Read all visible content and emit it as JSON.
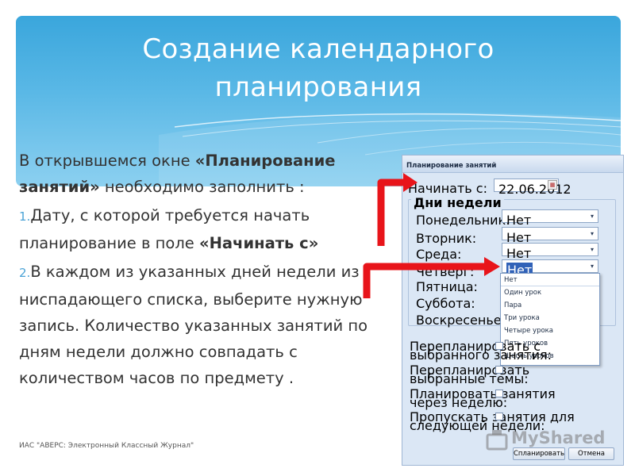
{
  "slide": {
    "title_line1": "Создание календарного",
    "title_line2": "планирования",
    "intro_part1": "В открывшемся окне ",
    "intro_bold": "«Планирование занятий»",
    "intro_part2": " необходимо заполнить :",
    "item1_num": "1.",
    "item1_part1": "Дату, с которой требуется начать планирование в поле ",
    "item1_bold": "«Начинать с»",
    "item2_num": "2.",
    "item2_text": "В каждом из указанных дней недели из ниспадающего списка, выберите нужную запись. Количество указанных занятий по дням  недели должно совпадать с количеством часов по предмету .",
    "footer": "ИАС \"АВЕРС: Электронный Классный Журнал\""
  },
  "dialog": {
    "title": "Планирование занятий",
    "start_label": "Начинать с:",
    "start_value": "22.06.2012",
    "group_title": "Дни недели",
    "days": [
      {
        "label": "Понедельник:",
        "value": "Нет"
      },
      {
        "label": "Вторник:",
        "value": "Нет"
      },
      {
        "label": "Среда:",
        "value": "Нет"
      },
      {
        "label": "Четверг:",
        "value": "Нет"
      },
      {
        "label": "Пятница:",
        "value": ""
      },
      {
        "label": "Суббота:",
        "value": ""
      },
      {
        "label": "Воскресенье:",
        "value": ""
      }
    ],
    "dropdown_options": [
      "Нет",
      "Один урок",
      "Пара",
      "Три урока",
      "Четыре урока",
      "Пять уроков",
      "Шесть уроков"
    ],
    "options": [
      {
        "line1": "Перепланировать с",
        "line2": "выбранного занятия:"
      },
      {
        "line1": "Перепланировать",
        "line2": "выбранные темы:"
      },
      {
        "line1": "Планировать занятия",
        "line2": "через неделю:"
      },
      {
        "line1": "Пропускать занятия для",
        "line2": "следующей недели:"
      }
    ],
    "plan_button": "Спланировать",
    "cancel_button": "Отмена"
  },
  "watermark": "MyShared",
  "colors": {
    "header": "#3aa6dc",
    "arrow": "#e8141a",
    "accent": "#4ba3d6"
  },
  "icons": {
    "dropdown": "chevron-down-icon",
    "calendar": "calendar-icon"
  }
}
